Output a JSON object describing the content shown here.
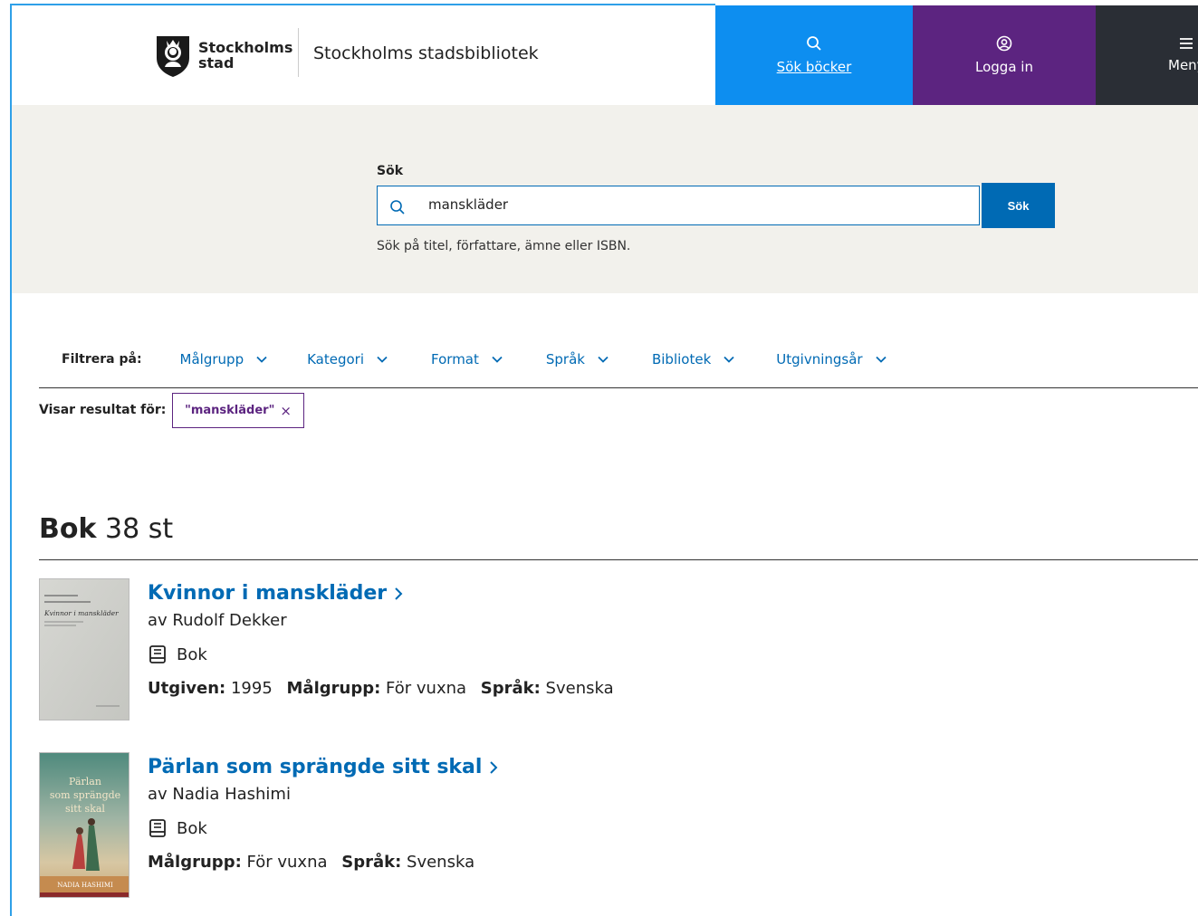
{
  "header": {
    "logo_line1": "Stockholms",
    "logo_line2": "stad",
    "site_name": "Stockholms stadsbibliotek",
    "nav": {
      "search_label": "Sök böcker",
      "login_label": "Logga in",
      "menu_label": "Meny"
    },
    "colors": {
      "search": "#0d8ef0",
      "login": "#5c2480",
      "menu": "#2a2e35"
    }
  },
  "search": {
    "label": "Sök",
    "value": "manskläder",
    "submit_label": "Sök",
    "hint": "Sök på titel, författare, ämne eller ISBN."
  },
  "filters": {
    "label": "Filtrera på:",
    "items": [
      {
        "label": "Målgrupp"
      },
      {
        "label": "Kategori"
      },
      {
        "label": "Format"
      },
      {
        "label": "Språk"
      },
      {
        "label": "Bibliotek"
      },
      {
        "label": "Utgivningsår"
      }
    ]
  },
  "active_filters": {
    "label": "Visar resultat för:",
    "chip": "\"manskläder\"",
    "remove_icon": "×"
  },
  "results": {
    "type": "Bok",
    "count": "38 st",
    "books": [
      {
        "title": "Kvinnor i manskläder",
        "author": "av Rudolf Dekker",
        "format": "Bok",
        "published_label": "Utgiven:",
        "published": "1995",
        "audience_label": "Målgrupp:",
        "audience": "För vuxna",
        "language_label": "Språk:",
        "language": "Svenska",
        "cover_text": "Kvinnor i manskläder"
      },
      {
        "title": "Pärlan som sprängde sitt skal",
        "author": "av Nadia Hashimi",
        "format": "Bok",
        "audience_label": "Målgrupp:",
        "audience": "För vuxna",
        "language_label": "Språk:",
        "language": "Svenska",
        "cover_title_line1": "Pärlan",
        "cover_title_line2": "som sprängde",
        "cover_title_line3": "sitt skal",
        "cover_author": "NADIA HASHIMI"
      }
    ]
  }
}
